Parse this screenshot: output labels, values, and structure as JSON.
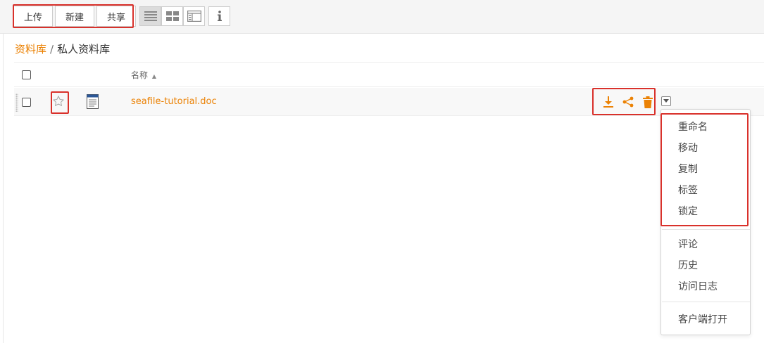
{
  "toolbar": {
    "upload_label": "上传",
    "new_label": "新建",
    "share_label": "共享"
  },
  "view_modes": [
    "list-view-icon",
    "grid-view-icon",
    "detail-view-icon"
  ],
  "info_icon": "info-icon",
  "breadcrumb": {
    "root": "资料库",
    "separator": "/",
    "current": "私人资料库"
  },
  "table": {
    "name_header": "名称",
    "sort_indicator": "▲"
  },
  "file": {
    "name": "seafile-tutorial.doc",
    "icon": "document-icon",
    "starred": false
  },
  "actions": [
    "download-icon",
    "share-icon",
    "delete-icon"
  ],
  "menu": {
    "group1": [
      "重命名",
      "移动",
      "复制",
      "标签",
      "锁定"
    ],
    "group2": [
      "评论",
      "历史",
      "访问日志"
    ],
    "group3": [
      "客户端打开"
    ]
  },
  "colors": {
    "accent": "#eb8205",
    "highlight": "#d9312b"
  }
}
